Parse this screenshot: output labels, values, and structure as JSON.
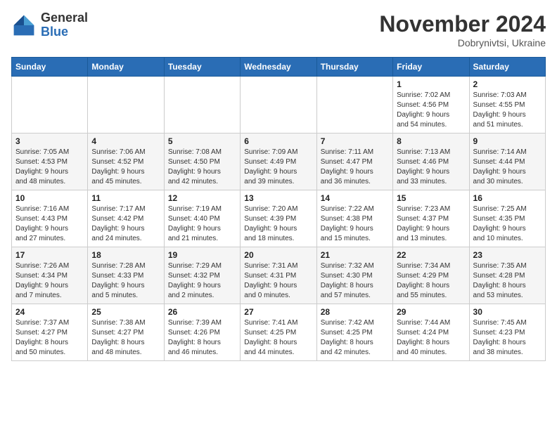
{
  "header": {
    "logo_general": "General",
    "logo_blue": "Blue",
    "month_title": "November 2024",
    "subtitle": "Dobrynivtsi, Ukraine"
  },
  "weekdays": [
    "Sunday",
    "Monday",
    "Tuesday",
    "Wednesday",
    "Thursday",
    "Friday",
    "Saturday"
  ],
  "weeks": [
    [
      {
        "day": "",
        "info": ""
      },
      {
        "day": "",
        "info": ""
      },
      {
        "day": "",
        "info": ""
      },
      {
        "day": "",
        "info": ""
      },
      {
        "day": "",
        "info": ""
      },
      {
        "day": "1",
        "info": "Sunrise: 7:02 AM\nSunset: 4:56 PM\nDaylight: 9 hours\nand 54 minutes."
      },
      {
        "day": "2",
        "info": "Sunrise: 7:03 AM\nSunset: 4:55 PM\nDaylight: 9 hours\nand 51 minutes."
      }
    ],
    [
      {
        "day": "3",
        "info": "Sunrise: 7:05 AM\nSunset: 4:53 PM\nDaylight: 9 hours\nand 48 minutes."
      },
      {
        "day": "4",
        "info": "Sunrise: 7:06 AM\nSunset: 4:52 PM\nDaylight: 9 hours\nand 45 minutes."
      },
      {
        "day": "5",
        "info": "Sunrise: 7:08 AM\nSunset: 4:50 PM\nDaylight: 9 hours\nand 42 minutes."
      },
      {
        "day": "6",
        "info": "Sunrise: 7:09 AM\nSunset: 4:49 PM\nDaylight: 9 hours\nand 39 minutes."
      },
      {
        "day": "7",
        "info": "Sunrise: 7:11 AM\nSunset: 4:47 PM\nDaylight: 9 hours\nand 36 minutes."
      },
      {
        "day": "8",
        "info": "Sunrise: 7:13 AM\nSunset: 4:46 PM\nDaylight: 9 hours\nand 33 minutes."
      },
      {
        "day": "9",
        "info": "Sunrise: 7:14 AM\nSunset: 4:44 PM\nDaylight: 9 hours\nand 30 minutes."
      }
    ],
    [
      {
        "day": "10",
        "info": "Sunrise: 7:16 AM\nSunset: 4:43 PM\nDaylight: 9 hours\nand 27 minutes."
      },
      {
        "day": "11",
        "info": "Sunrise: 7:17 AM\nSunset: 4:42 PM\nDaylight: 9 hours\nand 24 minutes."
      },
      {
        "day": "12",
        "info": "Sunrise: 7:19 AM\nSunset: 4:40 PM\nDaylight: 9 hours\nand 21 minutes."
      },
      {
        "day": "13",
        "info": "Sunrise: 7:20 AM\nSunset: 4:39 PM\nDaylight: 9 hours\nand 18 minutes."
      },
      {
        "day": "14",
        "info": "Sunrise: 7:22 AM\nSunset: 4:38 PM\nDaylight: 9 hours\nand 15 minutes."
      },
      {
        "day": "15",
        "info": "Sunrise: 7:23 AM\nSunset: 4:37 PM\nDaylight: 9 hours\nand 13 minutes."
      },
      {
        "day": "16",
        "info": "Sunrise: 7:25 AM\nSunset: 4:35 PM\nDaylight: 9 hours\nand 10 minutes."
      }
    ],
    [
      {
        "day": "17",
        "info": "Sunrise: 7:26 AM\nSunset: 4:34 PM\nDaylight: 9 hours\nand 7 minutes."
      },
      {
        "day": "18",
        "info": "Sunrise: 7:28 AM\nSunset: 4:33 PM\nDaylight: 9 hours\nand 5 minutes."
      },
      {
        "day": "19",
        "info": "Sunrise: 7:29 AM\nSunset: 4:32 PM\nDaylight: 9 hours\nand 2 minutes."
      },
      {
        "day": "20",
        "info": "Sunrise: 7:31 AM\nSunset: 4:31 PM\nDaylight: 9 hours\nand 0 minutes."
      },
      {
        "day": "21",
        "info": "Sunrise: 7:32 AM\nSunset: 4:30 PM\nDaylight: 8 hours\nand 57 minutes."
      },
      {
        "day": "22",
        "info": "Sunrise: 7:34 AM\nSunset: 4:29 PM\nDaylight: 8 hours\nand 55 minutes."
      },
      {
        "day": "23",
        "info": "Sunrise: 7:35 AM\nSunset: 4:28 PM\nDaylight: 8 hours\nand 53 minutes."
      }
    ],
    [
      {
        "day": "24",
        "info": "Sunrise: 7:37 AM\nSunset: 4:27 PM\nDaylight: 8 hours\nand 50 minutes."
      },
      {
        "day": "25",
        "info": "Sunrise: 7:38 AM\nSunset: 4:27 PM\nDaylight: 8 hours\nand 48 minutes."
      },
      {
        "day": "26",
        "info": "Sunrise: 7:39 AM\nSunset: 4:26 PM\nDaylight: 8 hours\nand 46 minutes."
      },
      {
        "day": "27",
        "info": "Sunrise: 7:41 AM\nSunset: 4:25 PM\nDaylight: 8 hours\nand 44 minutes."
      },
      {
        "day": "28",
        "info": "Sunrise: 7:42 AM\nSunset: 4:25 PM\nDaylight: 8 hours\nand 42 minutes."
      },
      {
        "day": "29",
        "info": "Sunrise: 7:44 AM\nSunset: 4:24 PM\nDaylight: 8 hours\nand 40 minutes."
      },
      {
        "day": "30",
        "info": "Sunrise: 7:45 AM\nSunset: 4:23 PM\nDaylight: 8 hours\nand 38 minutes."
      }
    ]
  ]
}
